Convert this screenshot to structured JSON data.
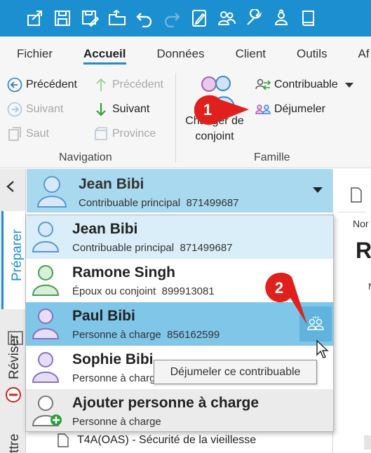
{
  "ribbon_tabs": [
    "Fichier",
    "Accueil",
    "Données",
    "Client",
    "Outils",
    "Af"
  ],
  "navigation": {
    "previous": "Précédent",
    "previous_disabled": "Précédent",
    "next_disabled": "Suivant",
    "next": "Suivant",
    "jump": "Saut",
    "province": "Province",
    "group_label": "Navigation"
  },
  "famille": {
    "change_spouse_line1": "Changer de",
    "change_spouse_line2": "conjoint",
    "taxpayer": "Contribuable",
    "unsplit": "Déjumeler",
    "group_label": "Famille"
  },
  "left_rail": {
    "prepare": "Préparer",
    "review": "Réviser",
    "transmit": "ttre"
  },
  "current_taxpayer": {
    "name": "Jean Bibi",
    "role": "Contribuable principal",
    "sin": "871499687"
  },
  "right_panel": {
    "label_top": "Nor",
    "label_big": "R",
    "label_small": "N"
  },
  "people": [
    {
      "name": "Jean Bibi",
      "role": "Contribuable principal",
      "sin": "871499687",
      "color": "#5b97d1"
    },
    {
      "name": "Ramone Singh",
      "role": "Époux ou conjoint",
      "sin": "899913081",
      "color": "#4a9b55"
    },
    {
      "name": "Paul Bibi",
      "role": "Personne à charge",
      "sin": "856162599",
      "color": "#8a6fc3"
    },
    {
      "name": "Sophie Bibi",
      "role": "Personne à charge",
      "sin": "",
      "color": "#8a6fc3"
    }
  ],
  "add_dependent": {
    "label": "Ajouter personne à charge",
    "sub": "Personne à charge"
  },
  "tooltip": "Déjumeler ce contribuable",
  "callouts": [
    "1",
    "2"
  ],
  "list_item": "T4A(OAS) - Sécurité de la vieillesse",
  "colors": {
    "accent": "#1b8fcf",
    "selected_row": "#a8d9ef",
    "hover_row": "#7fc6e8",
    "callout_red": "#e0201c"
  }
}
